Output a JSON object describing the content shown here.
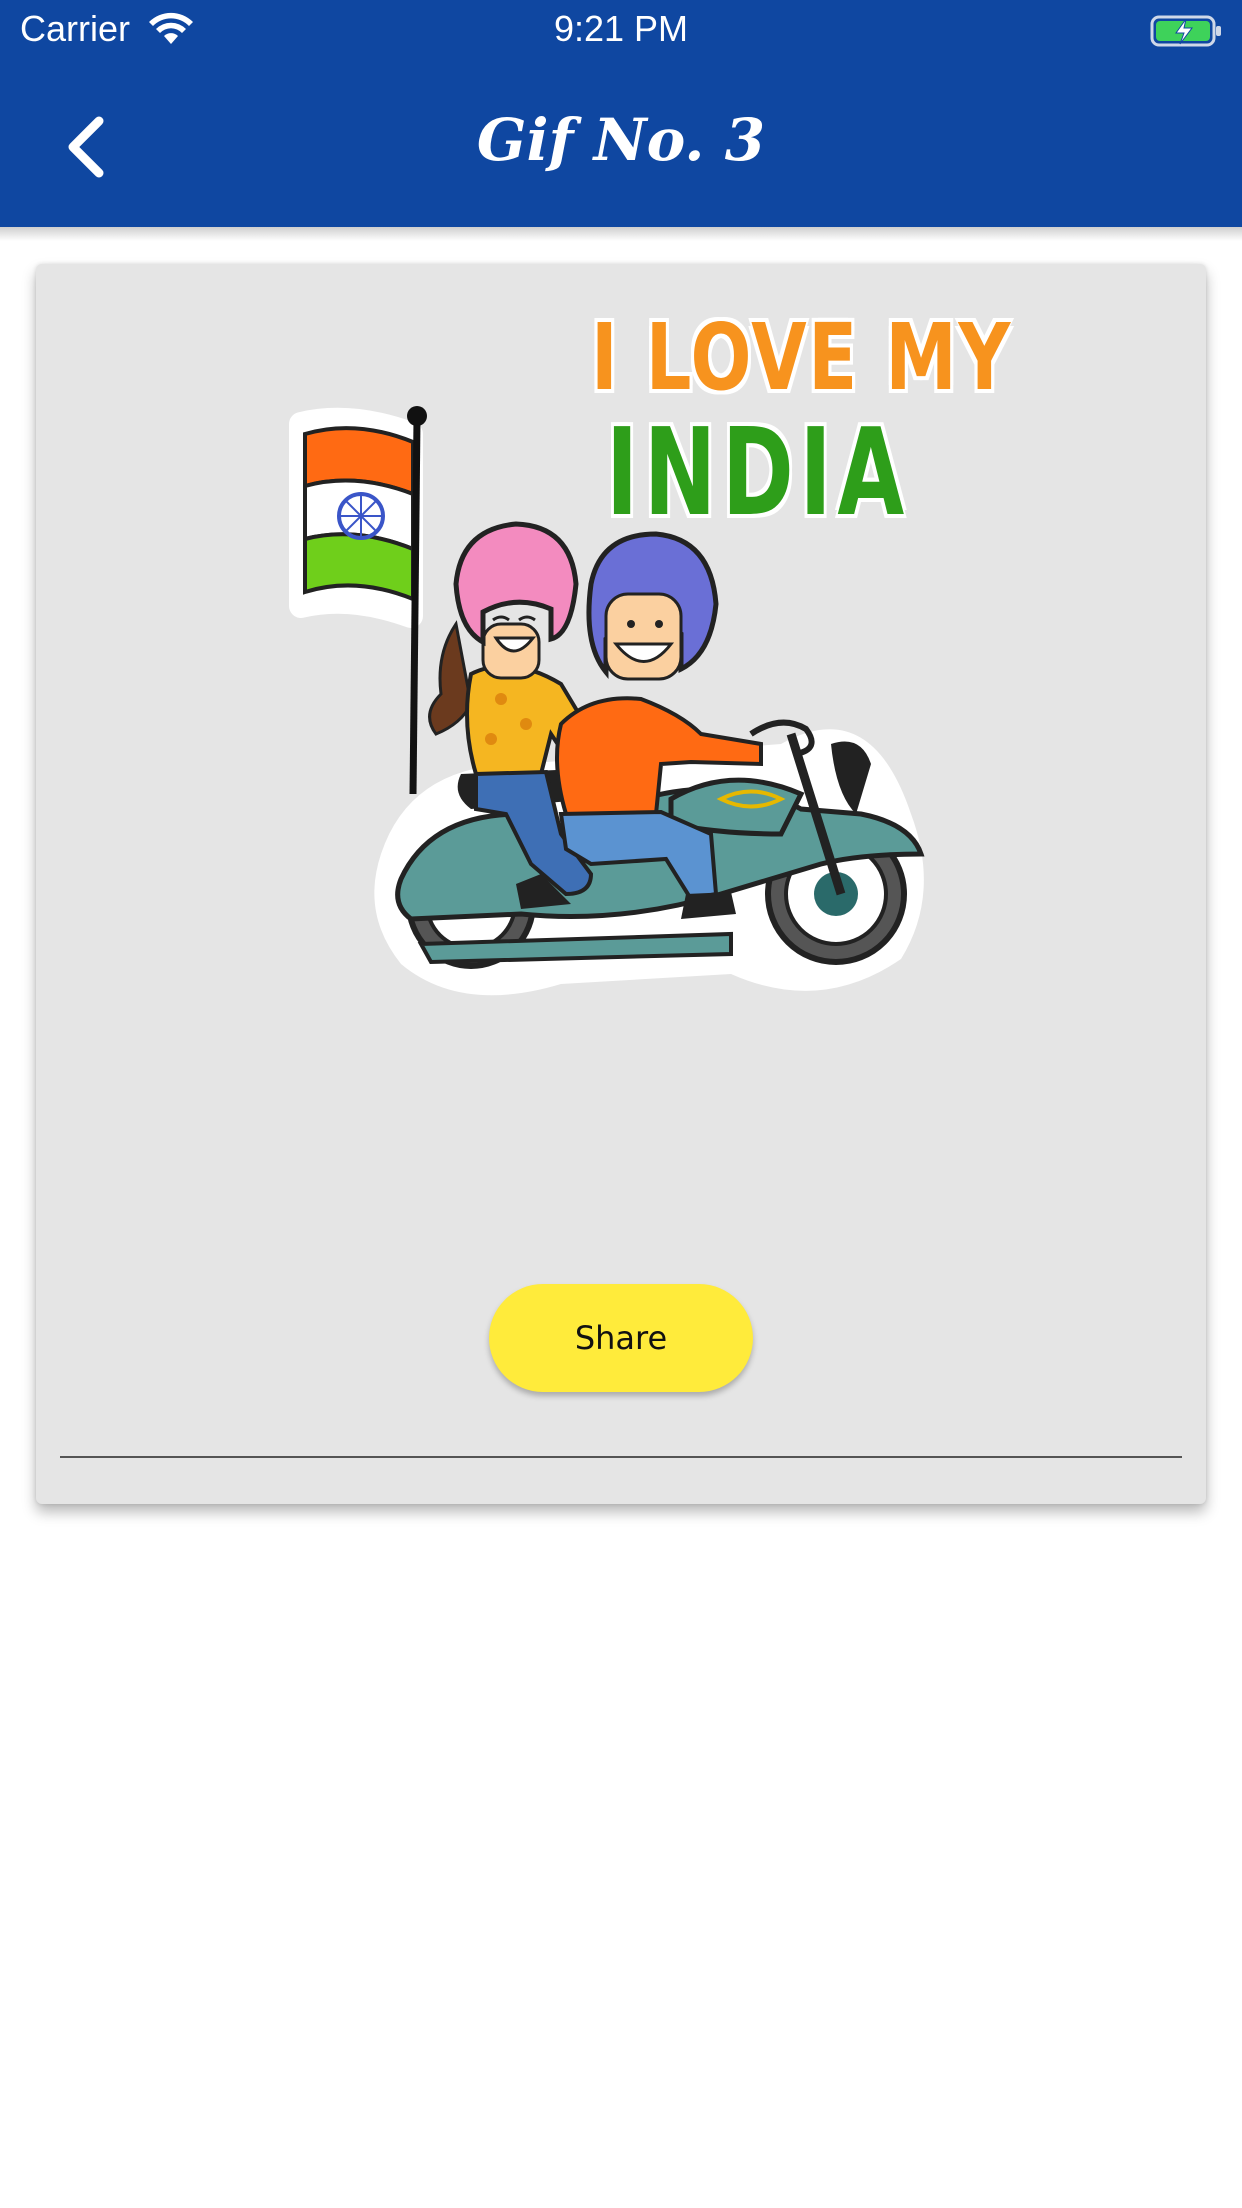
{
  "status_bar": {
    "carrier": "Carrier",
    "time": "9:21 PM",
    "wifi_icon": "wifi-icon",
    "battery_icon": "battery-charging-icon"
  },
  "header": {
    "title": "Gif No. 3",
    "back_icon": "chevron-left-icon",
    "background_color": "#0f47a1"
  },
  "card": {
    "gif": {
      "text_line1": "I LOVE MY",
      "text_line2": "INDIA",
      "line1_color": "#f7931e",
      "line2_color": "#2e9e1a"
    },
    "share_label": "Share",
    "share_color": "#ffeb3b"
  }
}
